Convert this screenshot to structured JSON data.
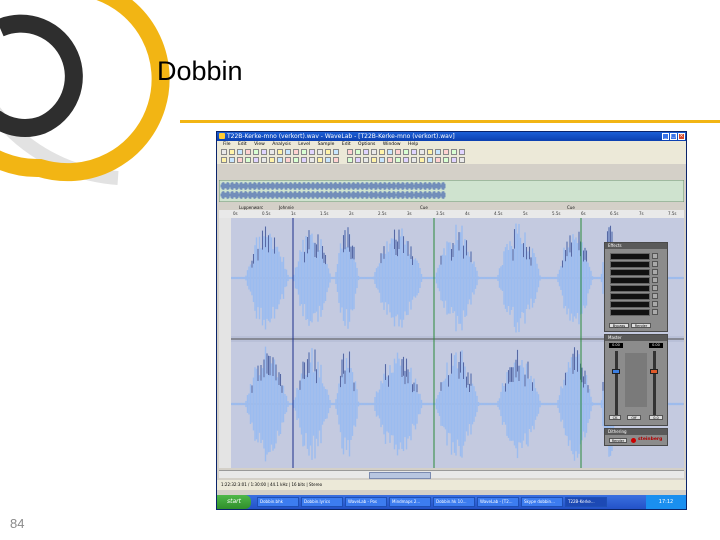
{
  "slide": {
    "title": "Dobbin",
    "page_number": "84"
  },
  "colors": {
    "accent_yellow": "#f2b514",
    "logo_dark": "#2e2e2e",
    "wave_fill": "#9bbcf0",
    "wave_background": "#b9c0d8",
    "xp_blue": "#2352c8"
  },
  "window": {
    "title": "T22B-Kerke-mno (verkort).wav - WaveLab - [T22B-Kerke-mno (verkort).wav]",
    "buttons": [
      "_",
      "□",
      "×"
    ]
  },
  "menu": {
    "items": [
      "File",
      "Edit",
      "View",
      "Analysis",
      "Level",
      "Sample",
      "Edit",
      "Options",
      "Window",
      "Help"
    ]
  },
  "ruler": {
    "ticks": [
      "0s",
      "0.5s",
      "1s",
      "1.5s",
      "2s",
      "2.5s",
      "3s",
      "3.5s",
      "4s",
      "4.5s",
      "5s",
      "5.5s",
      "6s",
      "6.5s",
      "7s",
      "7.5s"
    ],
    "markers": [
      "Luppenwarc",
      "Johnnie",
      "Cue",
      "Cue"
    ]
  },
  "panels": {
    "effects": {
      "title": "Effects",
      "buttons": [
        "Bypass",
        "Render"
      ]
    },
    "master": {
      "title": "Master",
      "values": [
        "0.00",
        "0.00"
      ],
      "labels": [
        "CK",
        "Off",
        "0.0"
      ]
    },
    "dither": {
      "title": "Dithering",
      "button": "Render",
      "brand": "steinberg"
    }
  },
  "statusbar": {
    "text": "1:22:32:3:01 / 1:30:00 | 44.1 kHz | 16 bits | Stereo"
  },
  "taskbar": {
    "start": "start",
    "tasks": [
      "Dobbin.bhk",
      "Dobbin.lyrics",
      "WaveLab - Pos",
      "Mindmaps 2...",
      "Dobbin.hk 10...",
      "WaveLab - [T2...",
      "Skype dobbin...",
      "T22B-Kerke..."
    ],
    "clock": "17:12"
  }
}
